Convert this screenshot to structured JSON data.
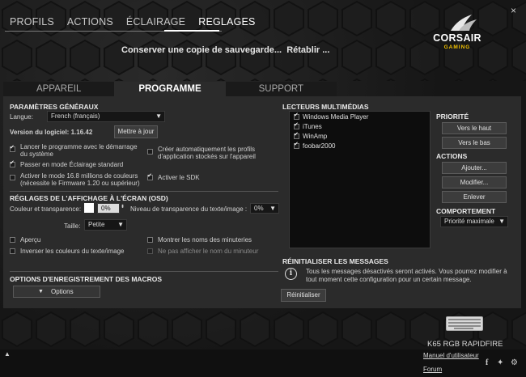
{
  "nav": {
    "items": [
      "PROFILS",
      "ACTIONS",
      "ÉCLAIRAGE",
      "REGLAGES"
    ],
    "close": "×"
  },
  "actions": {
    "save_copy": "Conserver une copie de sauvegarde...",
    "restore": "Rétablir ..."
  },
  "logo": {
    "word": "CORSAIR",
    "sub": "GAMING"
  },
  "tabs": [
    "APPAREIL",
    "PROGRAMME",
    "SUPPORT"
  ],
  "general": {
    "title": "PARAMÈTRES GÉNÉRAUX",
    "language_label": "Langue:",
    "language_value": "French (français)",
    "version_label": "Version du logiciel: 1.16.42",
    "update_button": "Mettre à jour",
    "opt_startup": "Lancer le programme avec le démarrage du système",
    "opt_standard": "Passer en mode Éclairage standard",
    "opt_16m": "Activer le mode 16.8 millions de couleurs (nécessite le Firmware 1.20 ou supérieur)",
    "opt_auto_profiles": "Créer automatiquement les profils d'application stockés sur l'appareil",
    "opt_sdk": "Activer le SDK"
  },
  "osd": {
    "title": "RÉGLAGES DE L'AFFICHAGE À L'ÉCRAN (OSD)",
    "color_label": "Couleur et transparence:",
    "color_value": "0%",
    "text_transp_label": "Niveau de transparence du texte/image :",
    "text_transp_value": "0%",
    "size_label": "Taille:",
    "size_value": "Petite",
    "preview": "Aperçu",
    "invert": "Inverser les couleurs du texte/image",
    "show_timers": "Montrer les noms des minuteries",
    "hide_timer": "Ne pas afficher le nom du minuteur"
  },
  "macros": {
    "title": "OPTIONS D'ENREGISTREMENT DES MACROS",
    "options_button": "Options"
  },
  "media": {
    "title": "LECTEURS MULTIMÉDIAS",
    "players": [
      "Windows Media Player",
      "iTunes",
      "WinAmp",
      "foobar2000"
    ]
  },
  "priority": {
    "title": "PRIORITÉ",
    "up": "Vers le haut",
    "down": "Vers le bas"
  },
  "actions_panel": {
    "title": "ACTIONS",
    "add": "Ajouter...",
    "edit": "Modifier...",
    "remove": "Enlever"
  },
  "behavior": {
    "title": "COMPORTEMENT",
    "value": "Priorité maximale"
  },
  "reset": {
    "title": "RÉINITIALISER LES MESSAGES",
    "text": "Tous les messages désactivés seront activés. Vous pourrez modifier à tout moment cette configuration pour un certain message.",
    "button": "Réinitialiser"
  },
  "device": {
    "name": "K65 RGB RAPIDFIRE",
    "manual": "Manuel d'utilisateur",
    "forum": "Forum"
  },
  "colors": {
    "accent": "#f0c000",
    "panel": "#2b2b2b",
    "background": "#141414"
  }
}
